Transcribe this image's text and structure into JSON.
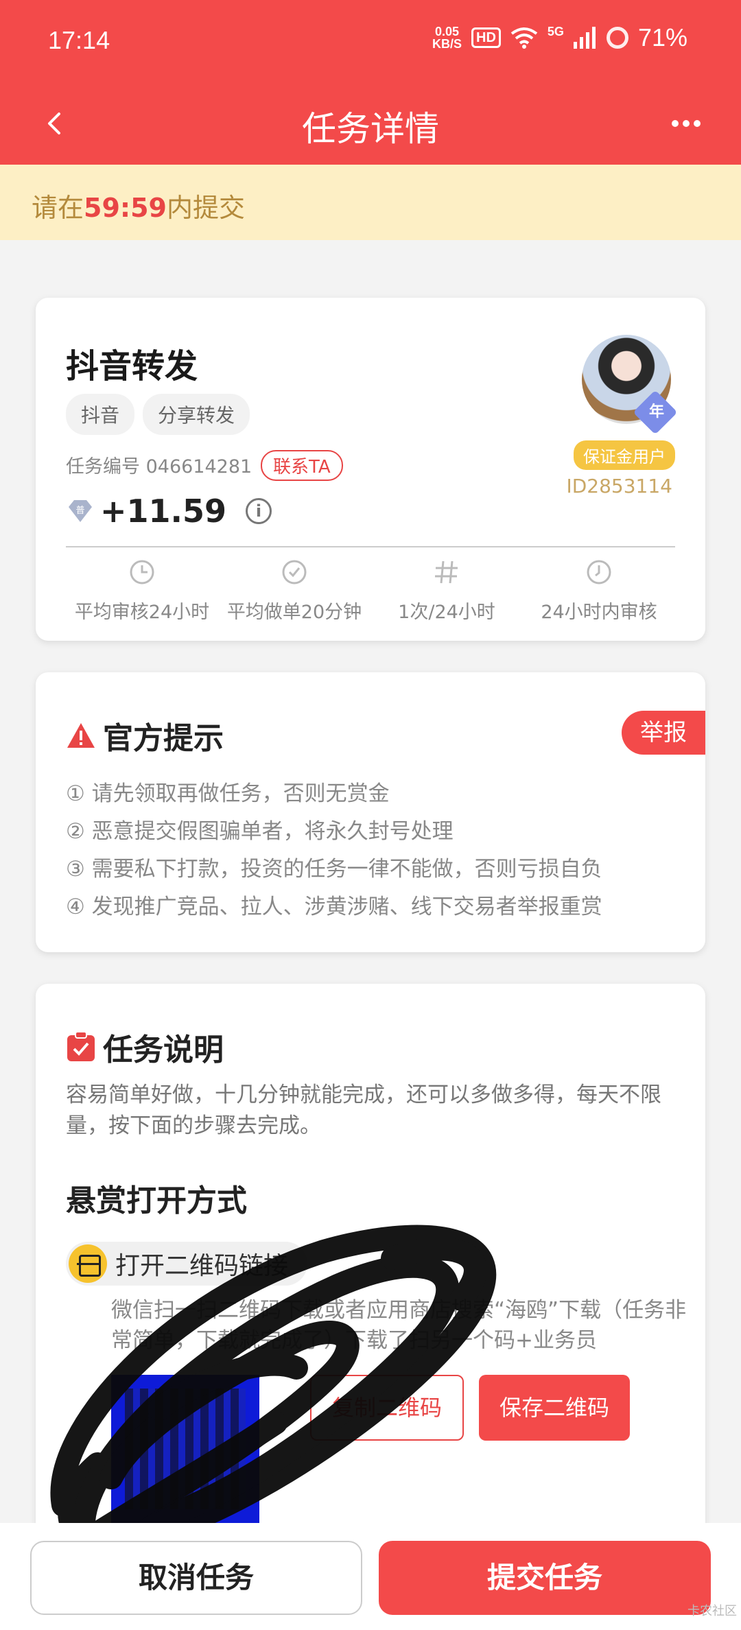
{
  "status_bar": {
    "time": "17:14",
    "net_speed": "0.05",
    "net_unit": "KB/S",
    "hd": "HD",
    "signal_type": "5G",
    "battery": "71%"
  },
  "header": {
    "title": "任务详情"
  },
  "countdown": {
    "prefix": "请在",
    "time": "59:59",
    "suffix": "内提交"
  },
  "task": {
    "title": "抖音转发",
    "tags": [
      "抖音",
      "分享转发"
    ],
    "task_no_label": "任务编号 046614281",
    "contact_label": "联系TA",
    "gem_label": "普",
    "reward": "+11.59",
    "user": {
      "avatar_badge": "年",
      "deposit_label": "保证金用户",
      "id": "ID2853114"
    },
    "stats": [
      {
        "icon": "review-clock-icon",
        "label": "平均审核24小时"
      },
      {
        "icon": "check-clock-icon",
        "label": "平均做单20分钟"
      },
      {
        "icon": "hash-icon",
        "label": "1次/24小时"
      },
      {
        "icon": "clock-icon",
        "label": "24小时内审核"
      }
    ]
  },
  "notice": {
    "title": "官方提示",
    "report_label": "举报",
    "items": [
      "① 请先领取再做任务，否则无赏金",
      "② 恶意提交假图骗单者，将永久封号处理",
      "③ 需要私下打款，投资的任务一律不能做，否则亏损自负",
      "④ 发现推广竞品、拉人、涉黄涉赌、线下交易者举报重赏"
    ]
  },
  "description": {
    "title": "任务说明",
    "text": "容易简单好做，十几分钟就能完成，还可以多做多得，每天不限量，按下面的步骤去完成。",
    "open_method_title": "悬赏打开方式",
    "step_label": "打开二维码链接",
    "step_text": "微信扫一扫二维码下载或者应用商店搜索“海鸥”下载（任务非常简单，下载就完成了）下载了扫另一个码+业务员",
    "copy_qr_label": "复制二维码",
    "save_qr_label": "保存二维码"
  },
  "bottom": {
    "cancel_label": "取消任务",
    "submit_label": "提交任务"
  },
  "watermark": "卡农社区",
  "colors": {
    "primary": "#f34a4a",
    "banner": "#fdefc5",
    "gold": "#c9a766"
  }
}
